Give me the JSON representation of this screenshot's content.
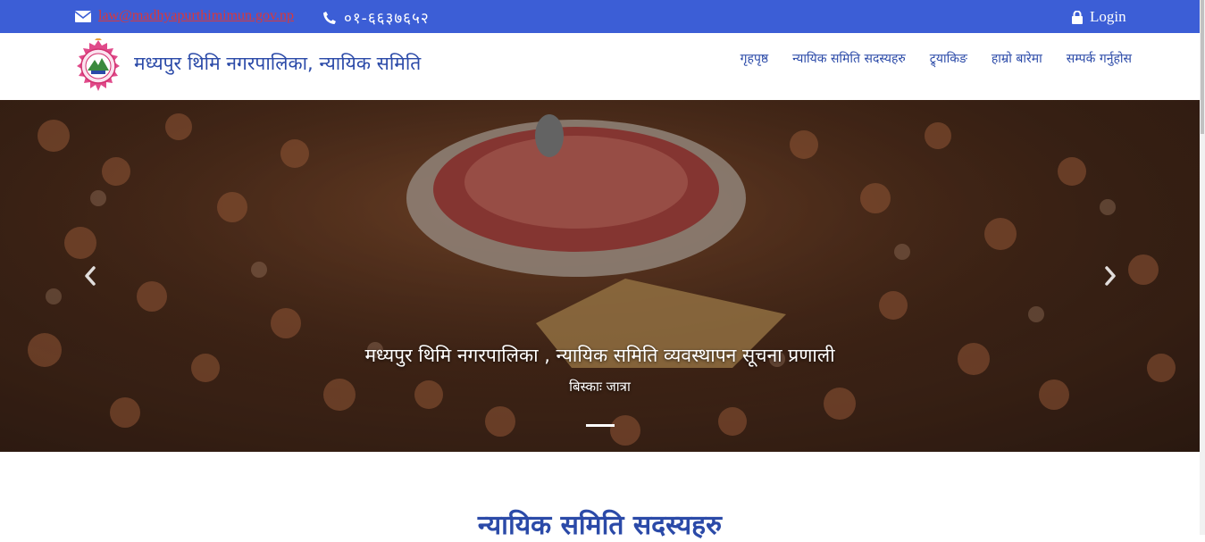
{
  "topbar": {
    "email": "law@madhyapurthimimun.gov.np",
    "phone": "०१-६६३७६५२",
    "login_label": "Login",
    "colors": {
      "background": "#3c5ed6",
      "email": "#d9383a"
    }
  },
  "header": {
    "title": "मध्यपुर थिमि नगरपालिका, न्यायिक समिति",
    "nav": [
      {
        "label": "गृहपृष्ठ"
      },
      {
        "label": "न्यायिक समिति सदस्यहरु"
      },
      {
        "label": "ट्र्याकिङ"
      },
      {
        "label": "हाम्रो बारेमा"
      },
      {
        "label": "सम्पर्क गर्नुहोस"
      }
    ]
  },
  "hero": {
    "caption_title": "मध्यपुर थिमि नगरपालिका , न्यायिक समिति व्यवस्थापन सूचना प्रणाली",
    "caption_subtitle": "बिस्काः जात्रा"
  },
  "section": {
    "title": "न्यायिक समिति सदस्यहरु"
  },
  "icons": {
    "email": "envelope-icon",
    "phone": "phone-icon",
    "login": "lock-icon",
    "prev": "chevron-left-icon",
    "next": "chevron-right-icon"
  },
  "accent_color": "#2b4aa8"
}
